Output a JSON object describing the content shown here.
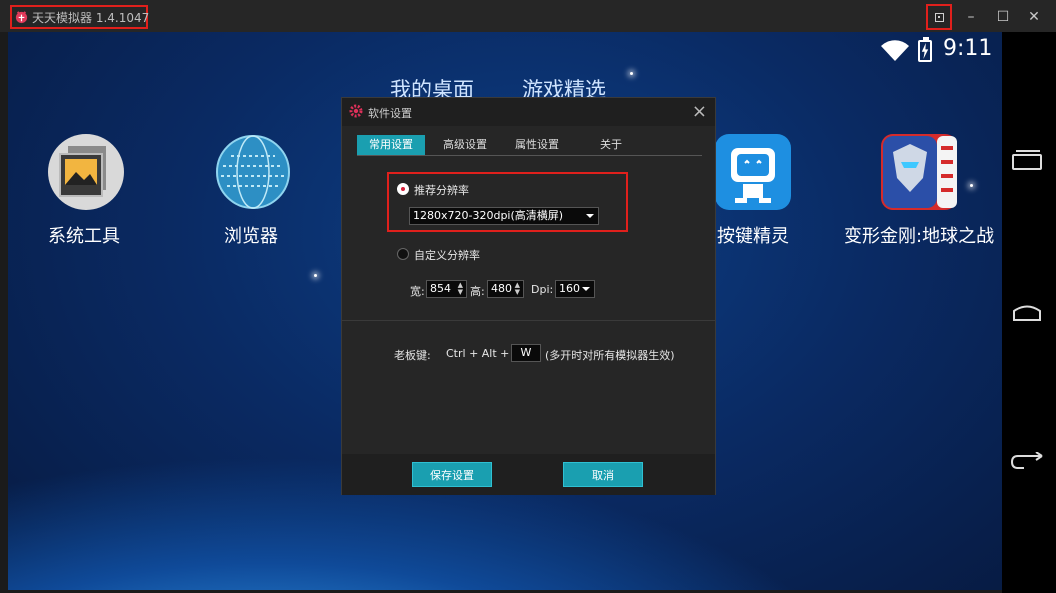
{
  "window": {
    "title": "天天模拟器 1.4.1047",
    "controls": {
      "minimize": "–",
      "maximize": "☐",
      "close": "✕"
    }
  },
  "status_bar": {
    "time": "9:11"
  },
  "home": {
    "tabs": [
      "我的桌面",
      "游戏精选"
    ],
    "apps": [
      {
        "label": "系统工具",
        "icon": "system-tools-icon"
      },
      {
        "label": "浏览器",
        "icon": "browser-globe-icon"
      },
      {
        "label": "按键精灵",
        "icon": "robot-icon"
      },
      {
        "label": "变形金刚:地球之战",
        "icon": "transformers-icon"
      }
    ]
  },
  "dialog": {
    "title": "软件设置",
    "tabs": [
      {
        "label": "常用设置",
        "active": true
      },
      {
        "label": "高级设置",
        "active": false
      },
      {
        "label": "属性设置",
        "active": false
      },
      {
        "label": "关于",
        "active": false
      }
    ],
    "recommended": {
      "label": "推荐分辨率",
      "selected": true,
      "value": "1280x720-320dpi(高清横屏)"
    },
    "custom": {
      "label": "自定义分辨率",
      "selected": false,
      "width_label": "宽:",
      "width": "854",
      "height_label": "高:",
      "height": "480",
      "dpi_label": "Dpi:",
      "dpi": "160"
    },
    "boss_key": {
      "label": "老板键:",
      "combo": "Ctrl + Alt +",
      "key": "W",
      "note": "(多开时对所有模拟器生效)"
    },
    "buttons": {
      "save": "保存设置",
      "cancel": "取消"
    }
  },
  "colors": {
    "accent": "#1a9fb0",
    "highlight_red": "#e0201c",
    "dialog_bg": "#262626"
  }
}
